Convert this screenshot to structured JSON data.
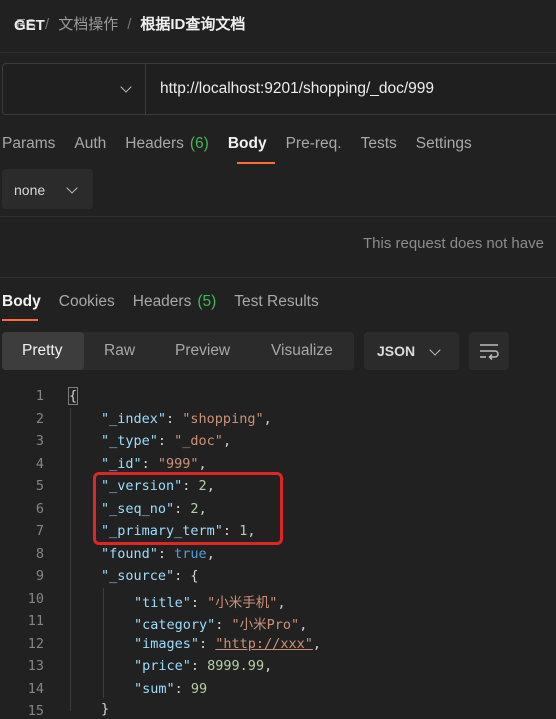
{
  "breadcrumb": {
    "items": [
      "ES",
      "文档操作"
    ],
    "current": "根据ID查询文档"
  },
  "request": {
    "method": "GET",
    "url": "http://localhost:9201/shopping/_doc/999"
  },
  "request_tabs": [
    {
      "label": "Params"
    },
    {
      "label": "Auth"
    },
    {
      "label": "Headers",
      "count": "(6)"
    },
    {
      "label": "Body"
    },
    {
      "label": "Pre-req."
    },
    {
      "label": "Tests"
    },
    {
      "label": "Settings"
    }
  ],
  "body_type": "none",
  "info_text": "This request does not have",
  "response_tabs": [
    {
      "label": "Body"
    },
    {
      "label": "Cookies"
    },
    {
      "label": "Headers",
      "count": "(5)"
    },
    {
      "label": "Test Results"
    }
  ],
  "view_modes": [
    "Pretty",
    "Raw",
    "Preview",
    "Visualize"
  ],
  "format": "JSON",
  "code": {
    "line_numbers": [
      "1",
      "2",
      "3",
      "4",
      "5",
      "6",
      "7",
      "8",
      "9",
      "10",
      "11",
      "12",
      "13",
      "14",
      "15"
    ],
    "open_brace": "{",
    "fields": [
      {
        "key": "\"_index\"",
        "value": "\"shopping\""
      },
      {
        "key": "\"_type\"",
        "value": "\"_doc\""
      },
      {
        "key": "\"_id\"",
        "value": "\"999\""
      },
      {
        "key": "\"_version\"",
        "value": "2"
      },
      {
        "key": "\"_seq_no\"",
        "value": "2"
      },
      {
        "key": "\"_primary_term\"",
        "value": "1"
      },
      {
        "key": "\"found\"",
        "value": "true"
      },
      {
        "key": "\"_source\"",
        "value": "{"
      }
    ],
    "source_fields": [
      {
        "key": "\"title\"",
        "value": "\"小米手机\""
      },
      {
        "key": "\"category\"",
        "value": "\"小米Pro\""
      },
      {
        "key": "\"images\"",
        "value": "\"http://xxx\""
      },
      {
        "key": "\"price\"",
        "value": "8999.99"
      },
      {
        "key": "\"sum\"",
        "value": "99"
      }
    ],
    "close_source": "}"
  }
}
